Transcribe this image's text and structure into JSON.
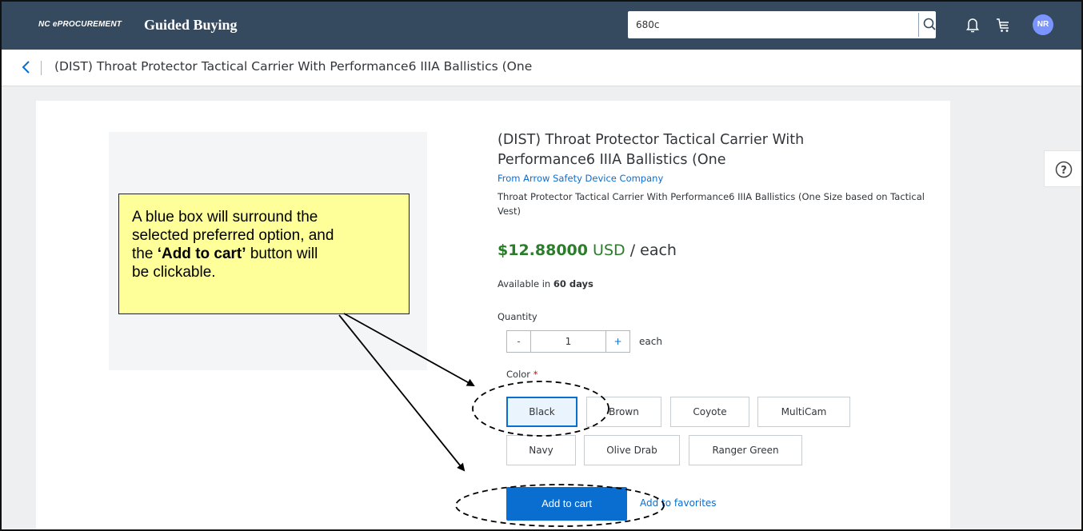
{
  "topbar": {
    "brand_small": "NC ePROCUREMENT",
    "brand_big": "Guided Buying",
    "search_value": "680c",
    "avatar_initials": "NR"
  },
  "header": {
    "title": "(DIST) Throat Protector Tactical Carrier With Performance6 IIIA Ballistics (One"
  },
  "product": {
    "title_line1": "(DIST) Throat Protector Tactical Carrier With",
    "title_line2": "Performance6 IIIA Ballistics (One",
    "supplier": "From Arrow Safety Device Company",
    "description": "Throat Protector Tactical Carrier With Performance6 IIIA Ballistics (One Size based on Tactical Vest)",
    "price_amount": "$12.88000",
    "price_currency": "USD",
    "price_unit": "/ each",
    "availability_prefix": "Available in",
    "availability_days": "60 days",
    "quantity_label": "Quantity",
    "quantity_minus": "-",
    "quantity_value": "1",
    "quantity_plus": "+",
    "quantity_unit": "each",
    "color_label": "Color",
    "color_required_marker": "*",
    "colors": [
      "Black",
      "Brown",
      "Coyote",
      "MultiCam",
      "Navy",
      "Olive Drab",
      "Ranger Green"
    ],
    "selected_color": "Black",
    "add_to_cart": "Add to cart",
    "add_to_favorites": "Add to favorites"
  },
  "callout": {
    "line1": "A blue box will surround the",
    "line2": "selected preferred option, and",
    "line3_prefix": "the",
    "line3_bold": "‘Add to cart’",
    "line3_suffix": "button will",
    "line4": "be clickable."
  },
  "icons": {
    "search": "search-icon",
    "bell": "bell-icon",
    "cart": "cart-icon",
    "back": "chevron-left-icon",
    "help": "help-icon"
  },
  "colors": {
    "topbar": "#354a5f",
    "accent": "#0a6ed1",
    "price": "#2b7d2b",
    "callout_bg": "#ffff99"
  }
}
